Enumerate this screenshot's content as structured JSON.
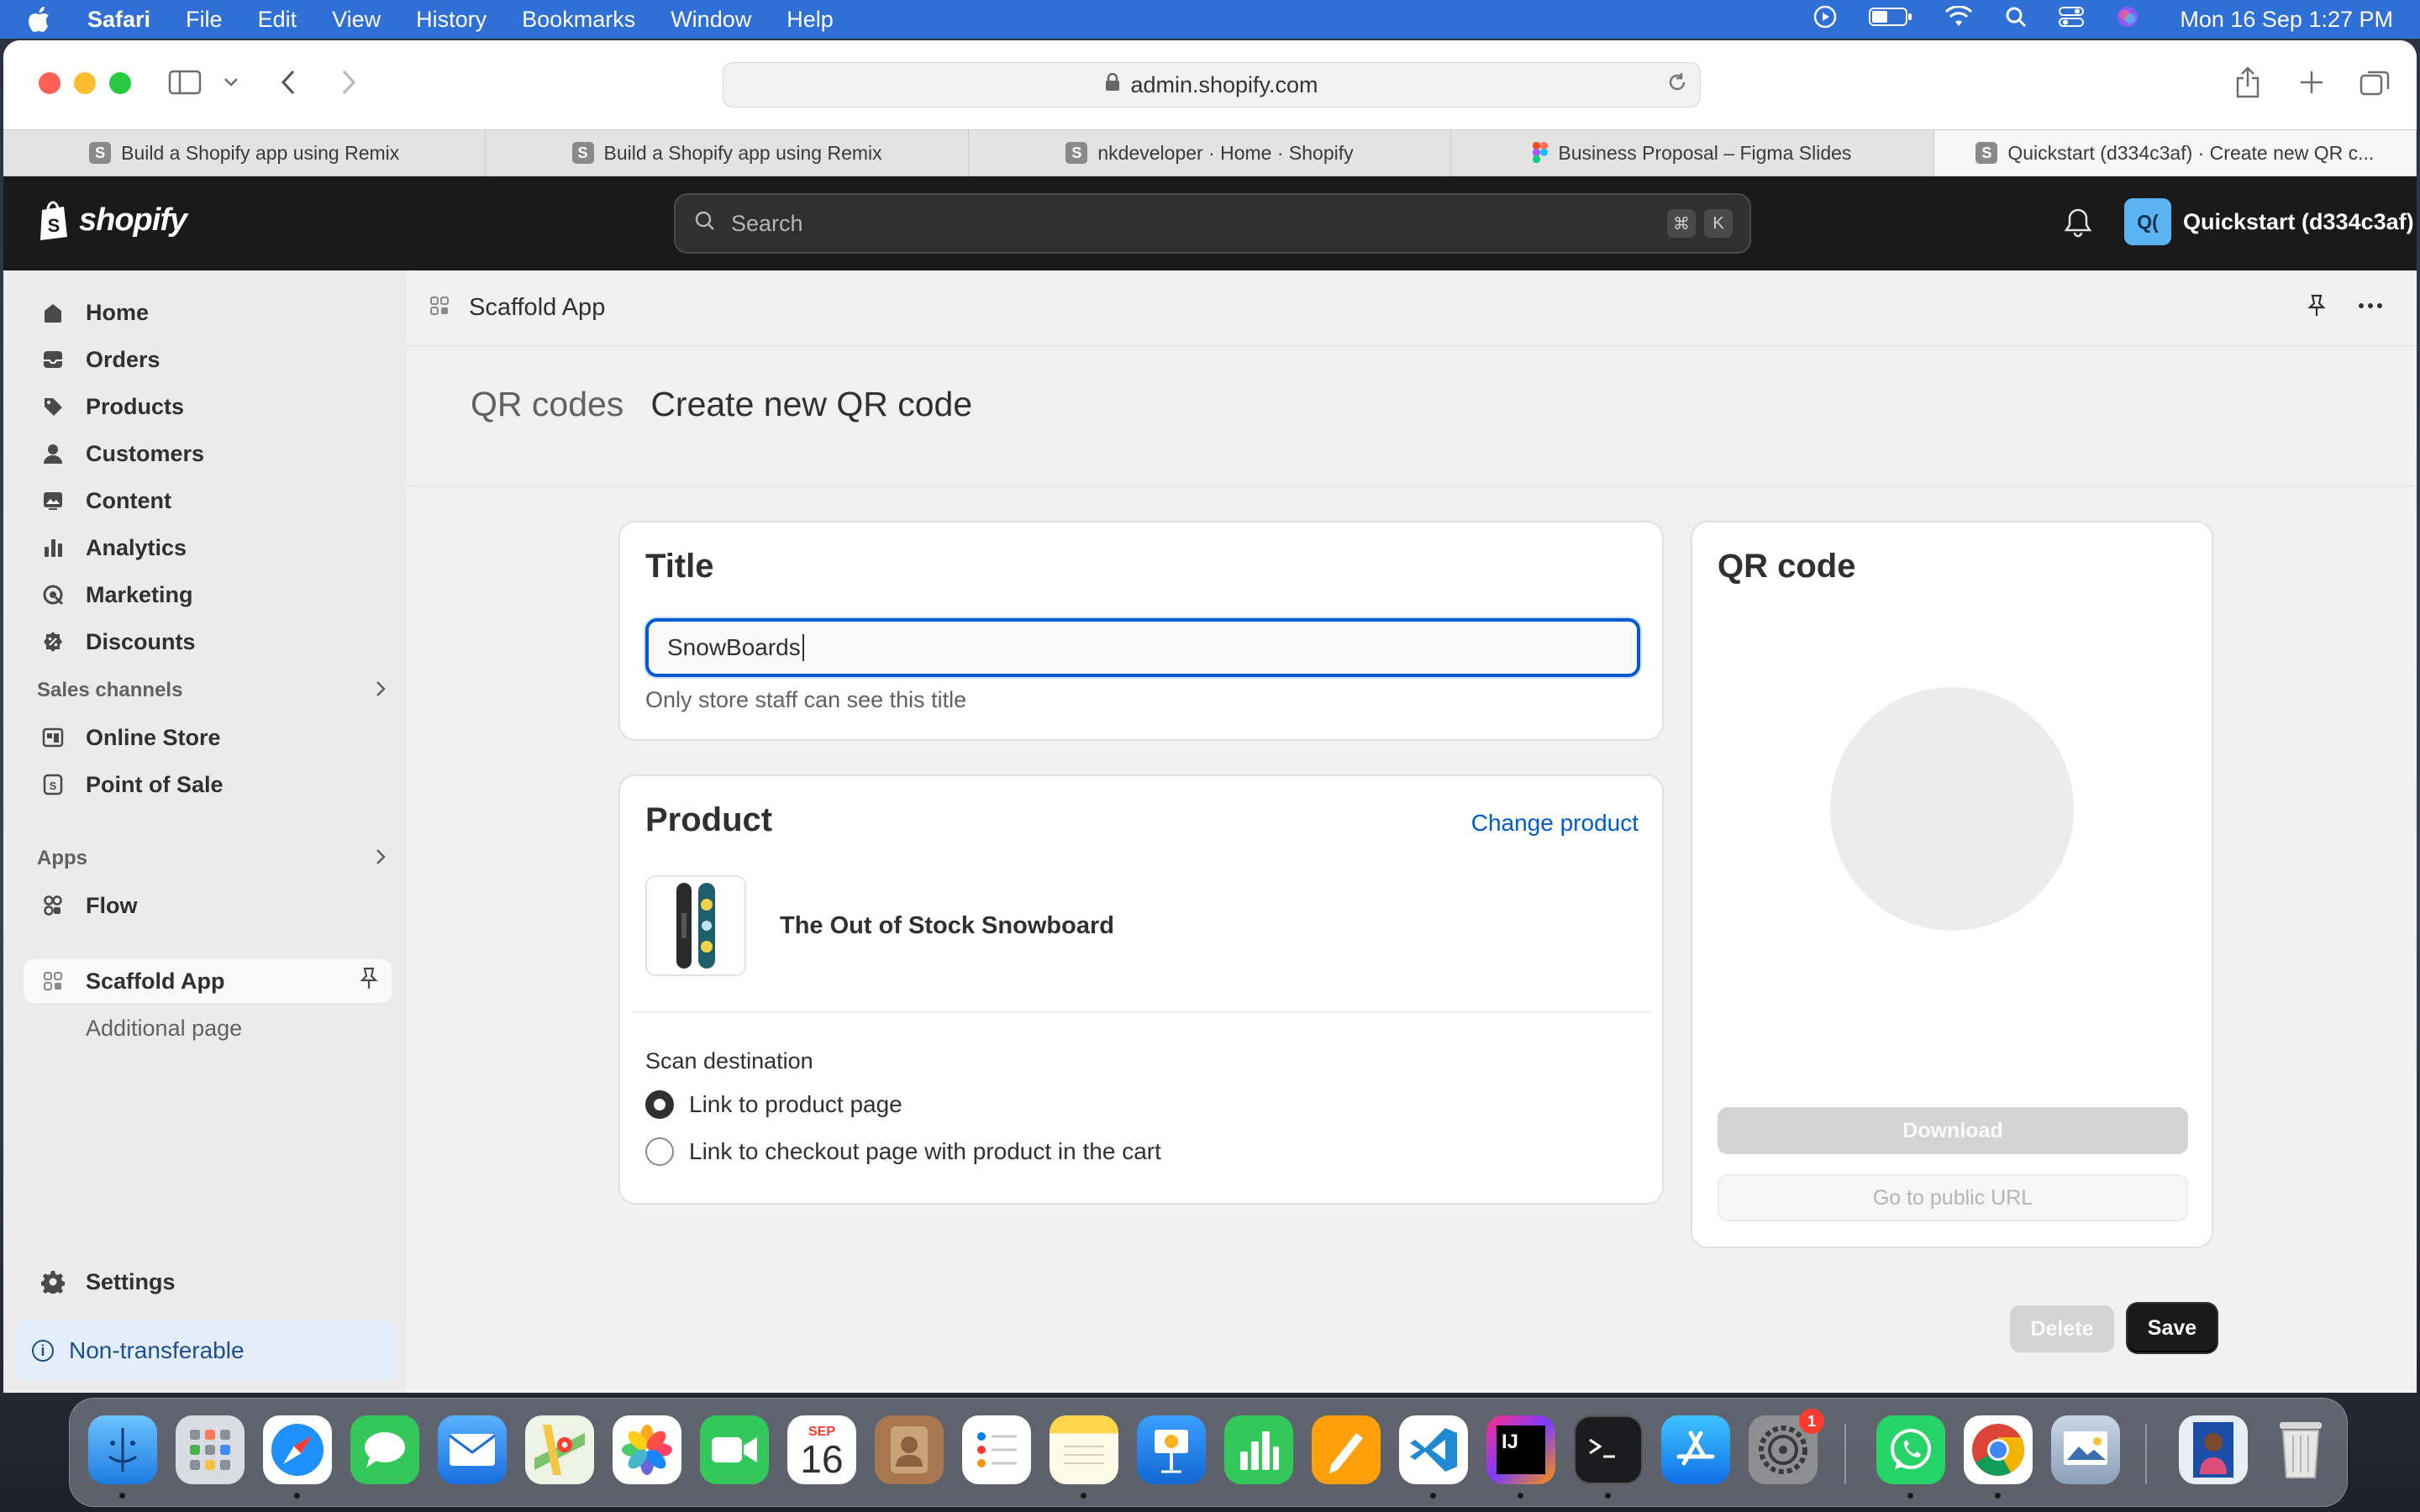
{
  "menubar": {
    "app": "Safari",
    "items": [
      "File",
      "Edit",
      "View",
      "History",
      "Bookmarks",
      "Window",
      "Help"
    ],
    "clock": "Mon 16 Sep  1:27 PM"
  },
  "browser": {
    "url": "admin.shopify.com",
    "tabs": [
      {
        "label": "Build a Shopify app using Remix",
        "icon": "S"
      },
      {
        "label": "Build a Shopify app using Remix",
        "icon": "S"
      },
      {
        "label": "nkdeveloper · Home · Shopify",
        "icon": "S"
      },
      {
        "label": "Business Proposal – Figma Slides",
        "icon": "figma"
      },
      {
        "label": "Quickstart (d334c3af) · Create new QR c...",
        "icon": "S"
      }
    ]
  },
  "shopify": {
    "logo_text": "shopify",
    "search_placeholder": "Search",
    "shortcut_keys": [
      "⌘",
      "K"
    ],
    "store_initials": "Q(",
    "store_name": "Quickstart (d334c3af)"
  },
  "sidebar": {
    "items": [
      {
        "label": "Home"
      },
      {
        "label": "Orders"
      },
      {
        "label": "Products"
      },
      {
        "label": "Customers"
      },
      {
        "label": "Content"
      },
      {
        "label": "Analytics"
      },
      {
        "label": "Marketing"
      },
      {
        "label": "Discounts"
      }
    ],
    "sales_channels_label": "Sales channels",
    "sales_channels": [
      {
        "label": "Online Store"
      },
      {
        "label": "Point of Sale"
      }
    ],
    "apps_label": "Apps",
    "apps": [
      {
        "label": "Flow"
      }
    ],
    "active_app": "Scaffold App",
    "active_app_sub": "Additional page",
    "settings": "Settings",
    "banner": "Non-transferable"
  },
  "app_header": {
    "title": "Scaffold App"
  },
  "page": {
    "breadcrumb": "QR codes",
    "title": "Create new QR code"
  },
  "title_card": {
    "heading": "Title",
    "value": "SnowBoards",
    "help": "Only store staff can see this title"
  },
  "product_card": {
    "heading": "Product",
    "change_link": "Change product",
    "product_name": "The Out of Stock Snowboard",
    "scan_label": "Scan destination",
    "options": [
      "Link to product page",
      "Link to checkout page with product in the cart"
    ],
    "selected_index": 0
  },
  "qr_card": {
    "heading": "QR code",
    "download": "Download",
    "public_url": "Go to public URL"
  },
  "actions": {
    "delete": "Delete",
    "save": "Save"
  },
  "dock": {
    "calendar_month": "SEP",
    "calendar_day": "16",
    "settings_badge": "1",
    "intellij_label": "IJ"
  }
}
